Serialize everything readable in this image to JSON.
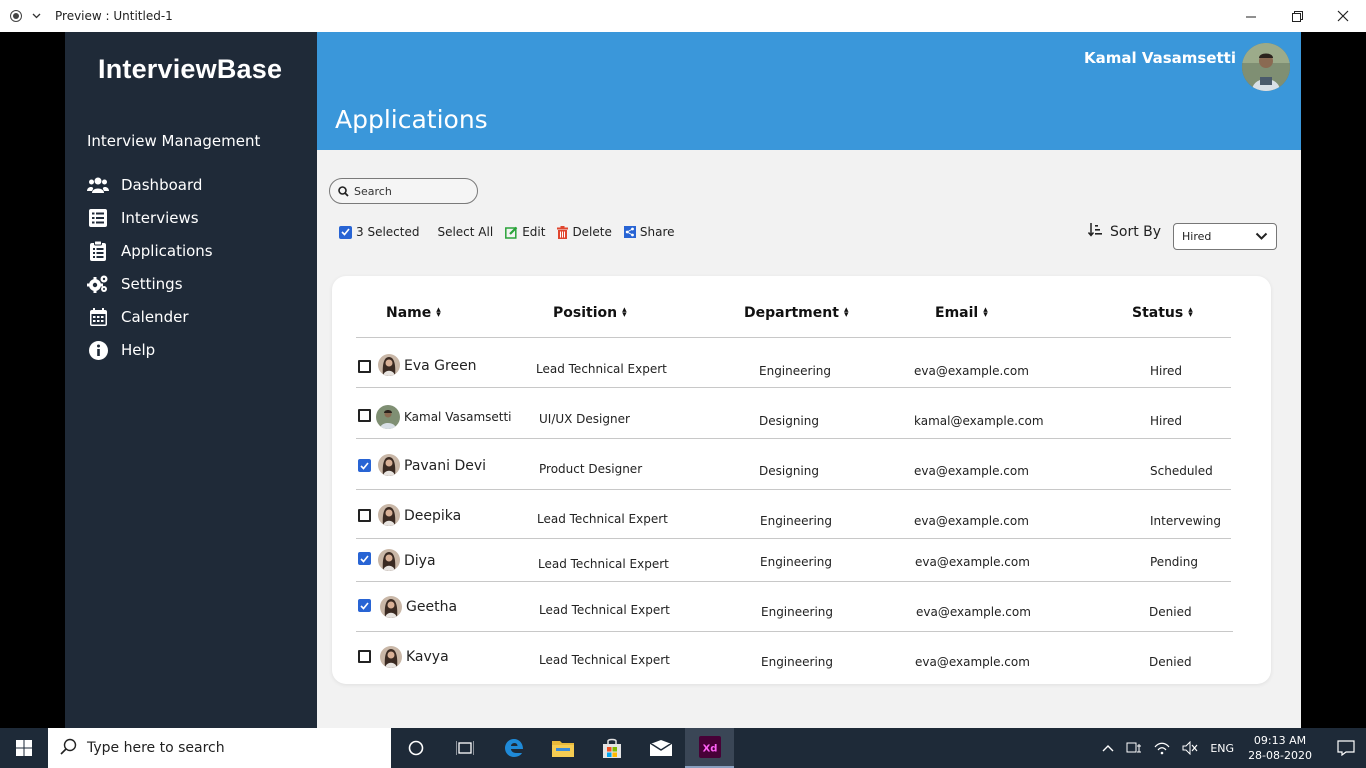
{
  "window": {
    "title": "Preview : Untitled-1",
    "controls": [
      "minimize",
      "restore",
      "close"
    ]
  },
  "sidebar": {
    "brand": "InterviewBase",
    "section_title": "Interview Management",
    "items": [
      {
        "label": "Dashboard",
        "icon": "users-icon"
      },
      {
        "label": "Interviews",
        "icon": "list-icon"
      },
      {
        "label": "Applications",
        "icon": "clipboard-icon"
      },
      {
        "label": "Settings",
        "icon": "gears-icon"
      },
      {
        "label": "Calender",
        "icon": "calendar-icon"
      },
      {
        "label": "Help",
        "icon": "info-icon"
      }
    ]
  },
  "header": {
    "page_title": "Applications",
    "user_name": "Kamal Vasamsetti"
  },
  "search": {
    "placeholder": "Search"
  },
  "toolbar": {
    "selected_label": "3 Selected",
    "select_all_label": "Select All",
    "edit_label": "Edit",
    "delete_label": "Delete",
    "share_label": "Share"
  },
  "sort": {
    "label": "Sort By",
    "selected": "Hired"
  },
  "table": {
    "columns": [
      "Name",
      "Position",
      "Department",
      "Email",
      "Status"
    ],
    "rows": [
      {
        "checked": false,
        "name": "Eva Green",
        "position": "Lead Technical Expert",
        "department": "Engineering",
        "email": "eva@example.com",
        "status": "Hired"
      },
      {
        "checked": false,
        "name": "Kamal Vasamsetti",
        "position": "UI/UX Designer",
        "department": "Designing",
        "email": "kamal@example.com",
        "status": "Hired"
      },
      {
        "checked": true,
        "name": "Pavani Devi",
        "position": "Product Designer",
        "department": "Designing",
        "email": "eva@example.com",
        "status": "Scheduled"
      },
      {
        "checked": false,
        "name": "Deepika",
        "position": "Lead Technical Expert",
        "department": "Engineering",
        "email": "eva@example.com",
        "status": "Intervewing"
      },
      {
        "checked": true,
        "name": "Diya",
        "position": "Lead Technical Expert",
        "department": "Engineering",
        "email": "eva@example.com",
        "status": "Pending"
      },
      {
        "checked": true,
        "name": "Geetha",
        "position": "Lead Technical Expert",
        "department": "Engineering",
        "email": "eva@example.com",
        "status": "Denied"
      },
      {
        "checked": false,
        "name": "Kavya",
        "position": "Lead Technical Expert",
        "department": "Engineering",
        "email": "eva@example.com",
        "status": "Denied"
      }
    ]
  },
  "taskbar": {
    "search_placeholder": "Type here to search",
    "apps": [
      "cortana-icon",
      "task-view-icon",
      "edge-icon",
      "file-explorer-icon",
      "store-icon",
      "mail-icon",
      "adobe-xd-icon"
    ],
    "language": "ENG",
    "time": "09:13 AM",
    "date": "28-08-2020"
  },
  "colors": {
    "header_blue": "#3a97da",
    "sidebar_dark": "#1f2a38",
    "checkbox_blue": "#2864d4",
    "delete_red": "#e0462f",
    "edit_green": "#2aa33a"
  }
}
